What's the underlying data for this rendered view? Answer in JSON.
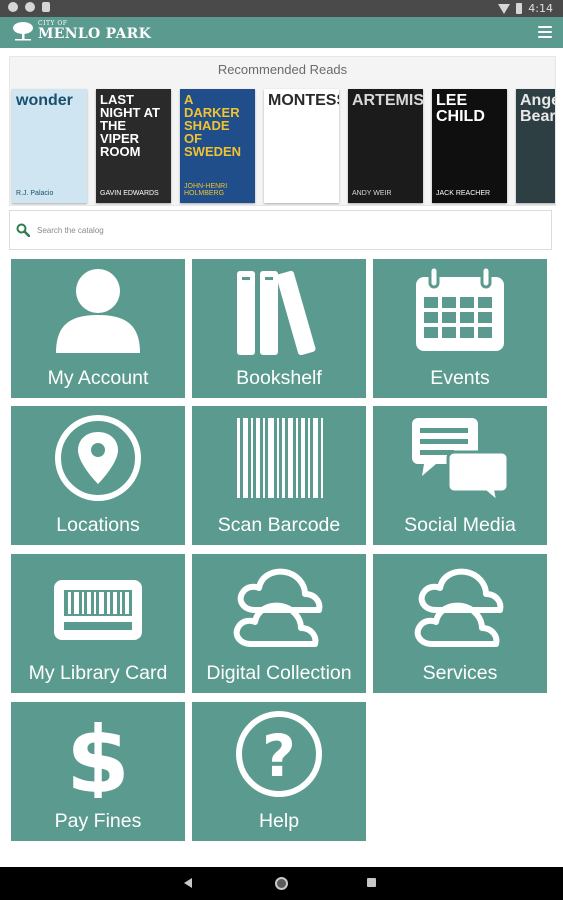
{
  "status_bar": {
    "time": "4:14"
  },
  "app_bar": {
    "logo_small": "CITY OF",
    "logo_big": "MENLO PARK"
  },
  "recommended": {
    "title": "Recommended Reads",
    "books": [
      {
        "title": "wonder",
        "author": "R.J. Palacio",
        "bg": "#cfe6f2",
        "fg": "#1b4f6b"
      },
      {
        "title": "LAST NIGHT AT THE VIPER ROOM",
        "author": "GAVIN EDWARDS",
        "bg": "#2a2a2a",
        "fg": "#ffffff"
      },
      {
        "title": "A DARKER SHADE OF SWEDEN",
        "author": "JOHN-HENRI HOLMBERG",
        "bg": "#1f4e8a",
        "fg": "#f2c230"
      },
      {
        "title": "MONTESSORI",
        "author": "",
        "bg": "#ffffff",
        "fg": "#2a2a2a"
      },
      {
        "title": "ARTEMIS",
        "author": "ANDY WEIR",
        "bg": "#1b1b1b",
        "fg": "#d8d8d8"
      },
      {
        "title": "LEE CHILD",
        "author": "JACK REACHER",
        "bg": "#0f0f0f",
        "fg": "#ffffff"
      },
      {
        "title": "Angel Bear",
        "author": "",
        "bg": "#2e3f44",
        "fg": "#e8e8e8"
      }
    ]
  },
  "search": {
    "placeholder": "Search the catalog"
  },
  "tiles": [
    {
      "label": "My Account",
      "icon": "person-icon"
    },
    {
      "label": "Bookshelf",
      "icon": "bookshelf-icon"
    },
    {
      "label": "Events",
      "icon": "calendar-icon"
    },
    {
      "label": "Locations",
      "icon": "location-pin-icon"
    },
    {
      "label": "Scan Barcode",
      "icon": "barcode-icon"
    },
    {
      "label": "Social Media",
      "icon": "chat-bubbles-icon"
    },
    {
      "label": "My Library Card",
      "icon": "library-card-icon"
    },
    {
      "label": "Digital Collection",
      "icon": "cloud-icon"
    },
    {
      "label": "Services",
      "icon": "cloud-icon"
    },
    {
      "label": "Pay Fines",
      "icon": "dollar-icon"
    },
    {
      "label": "Help",
      "icon": "help-icon"
    }
  ],
  "colors": {
    "primary": "#5b9b8f",
    "search_icon": "#2e7d4f"
  }
}
